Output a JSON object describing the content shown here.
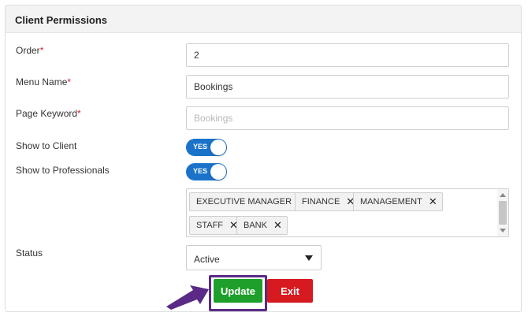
{
  "panel": {
    "title": "Client Permissions"
  },
  "form": {
    "order": {
      "label": "Order",
      "required": "*",
      "value": "2"
    },
    "menu_name": {
      "label": "Menu Name",
      "required": "*",
      "value": "Bookings"
    },
    "page_keyword": {
      "label": "Page Keyword",
      "required": "*",
      "value": "",
      "placeholder": "Bookings"
    },
    "show_to_client": {
      "label": "Show to Client",
      "toggle_text": "YES"
    },
    "show_to_professionals": {
      "label": "Show to Professionals",
      "toggle_text": "YES"
    },
    "roles": {
      "tags": [
        "EXECUTIVE MANAGER",
        "FINANCE",
        "MANAGEMENT",
        "STAFF",
        "BANK"
      ],
      "remove_glyph": "✕"
    },
    "status": {
      "label": "Status",
      "value": "Active"
    }
  },
  "actions": {
    "update_label": "Update",
    "exit_label": "Exit"
  },
  "colors": {
    "toggle_on": "#1a73c9",
    "update_button": "#1e9e2b",
    "exit_button": "#d71920",
    "highlight": "#5b2a86"
  }
}
